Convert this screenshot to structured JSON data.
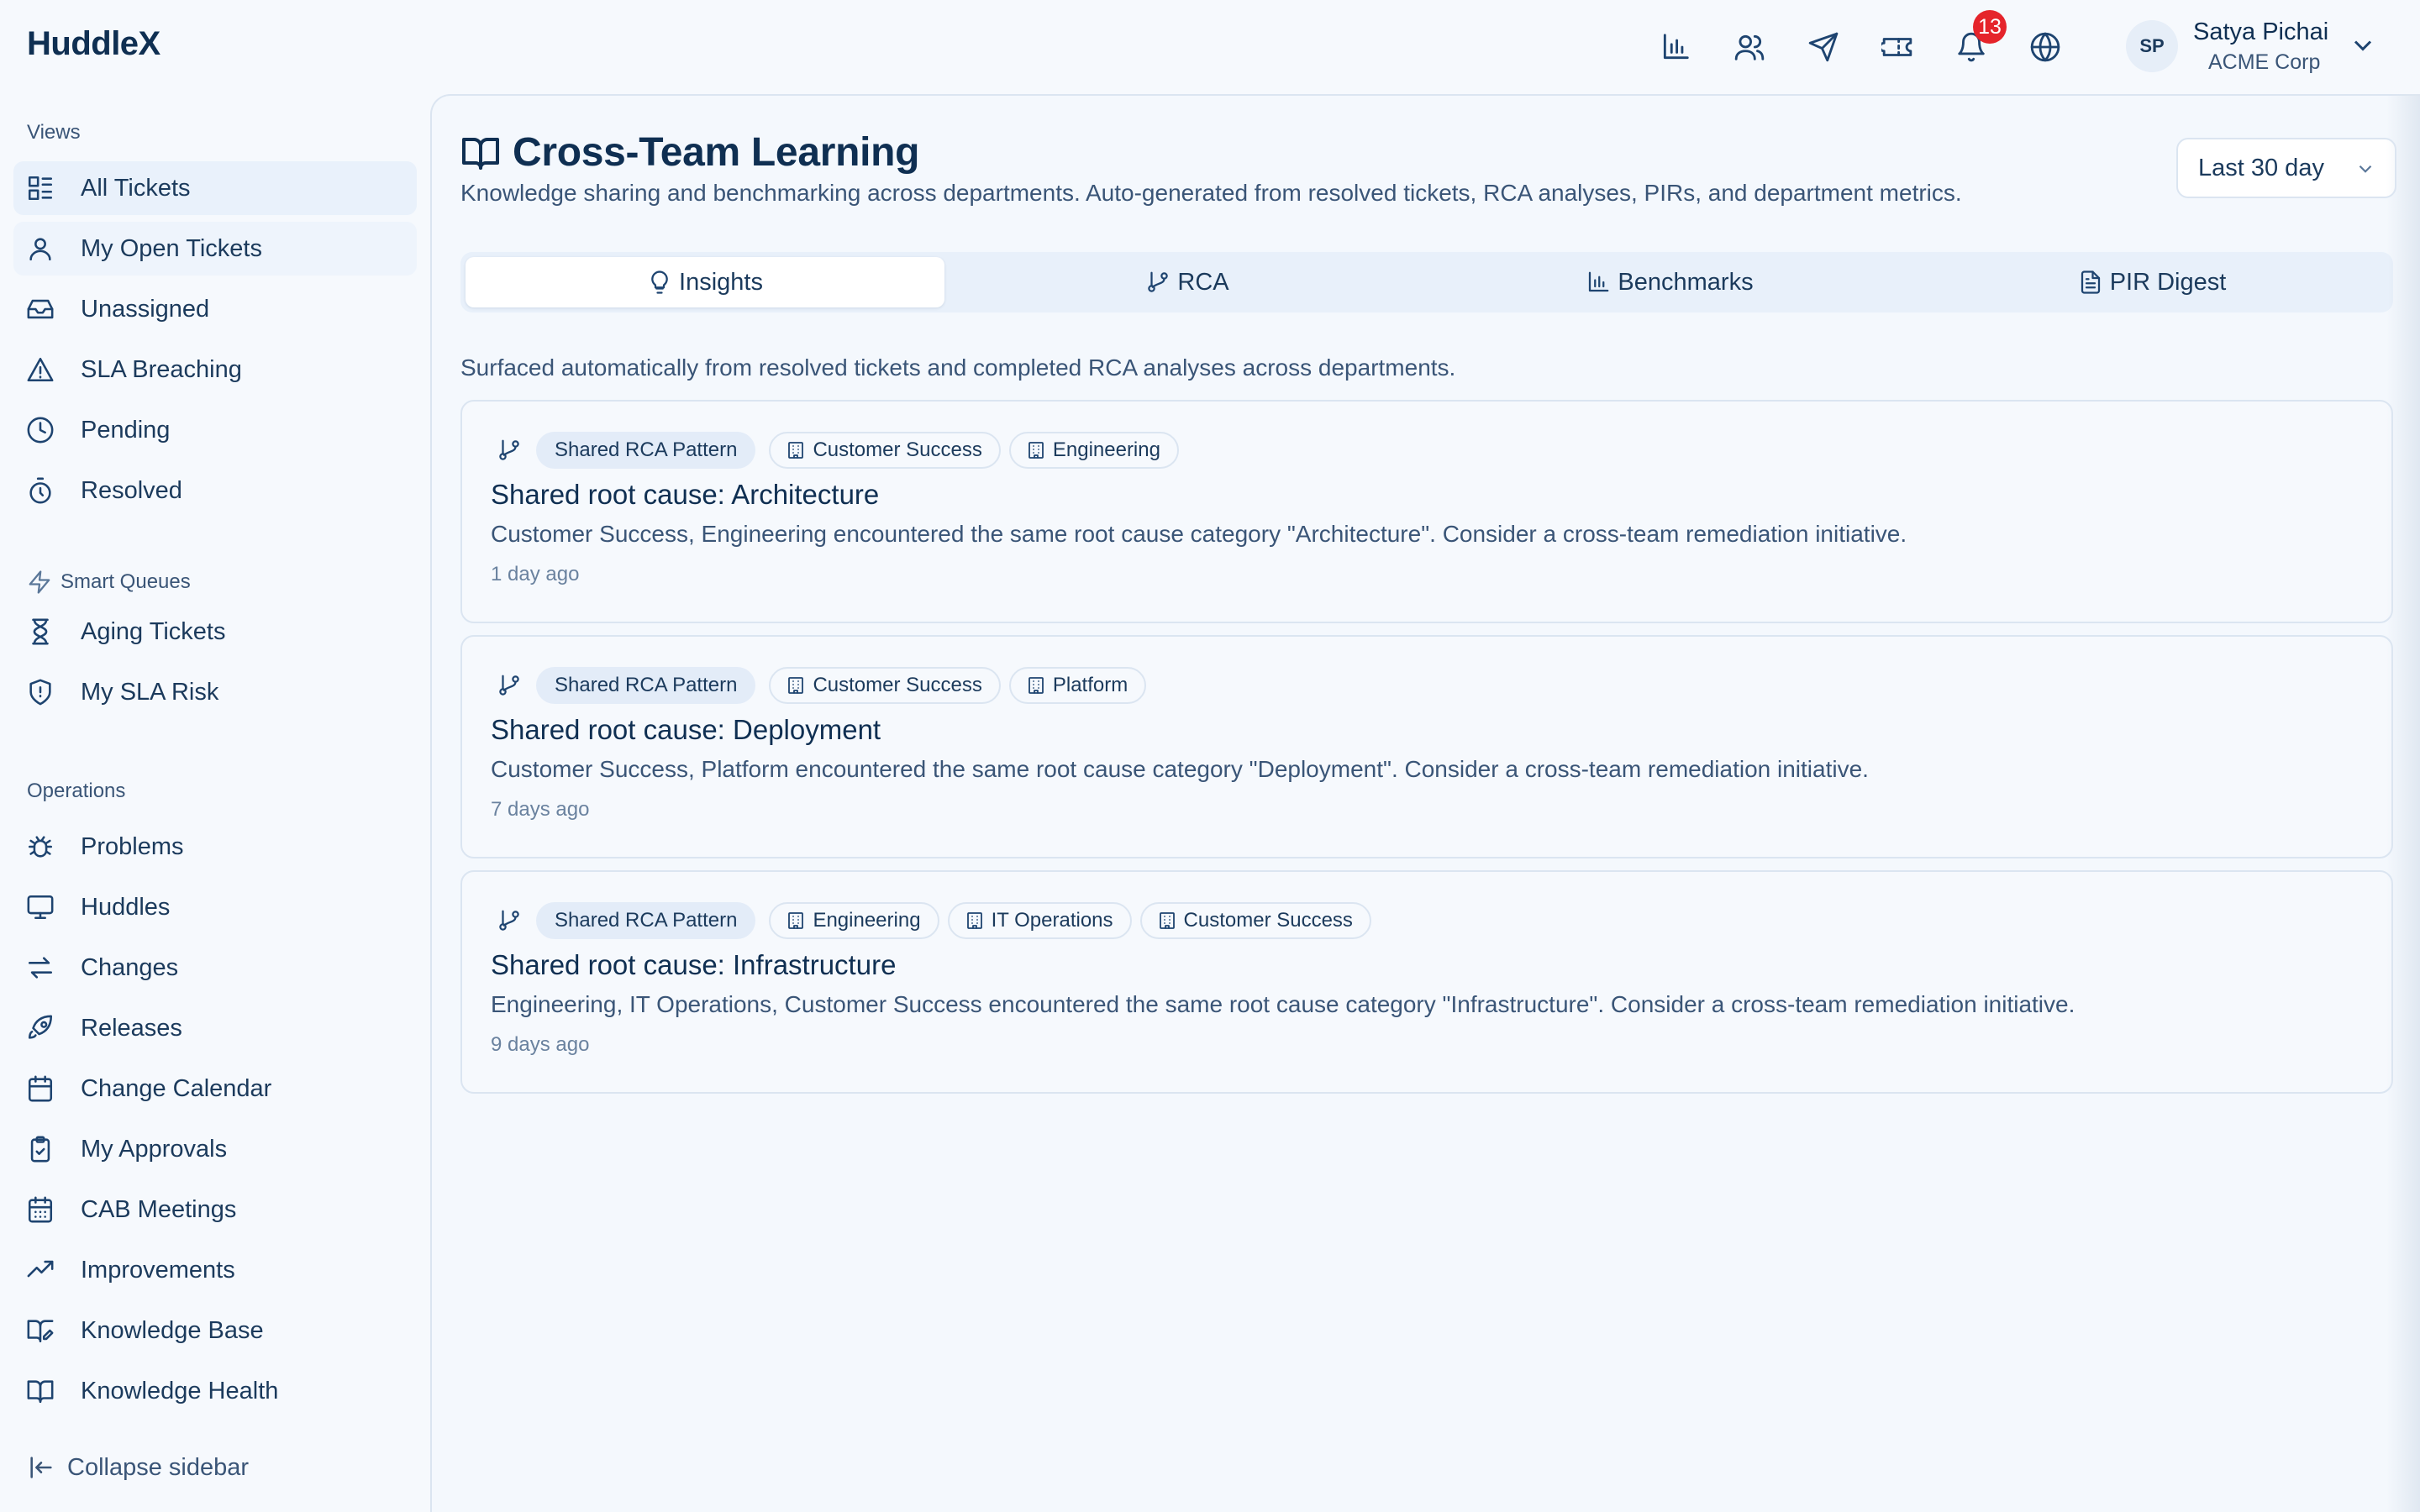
{
  "app": {
    "name": "HuddleX"
  },
  "topbar": {
    "icons": [
      "bar-chart-icon",
      "users-icon",
      "send-icon",
      "ticket-icon",
      "bell-icon",
      "globe-icon"
    ],
    "notification_count": "13",
    "user": {
      "initials": "SP",
      "name": "Satya Pichai",
      "org": "ACME Corp"
    }
  },
  "sidebar": {
    "views_label": "Views",
    "views": [
      {
        "label": "All Tickets",
        "icon": "list-icon"
      },
      {
        "label": "My Open Tickets",
        "icon": "user-icon"
      },
      {
        "label": "Unassigned",
        "icon": "inbox-icon"
      },
      {
        "label": "SLA Breaching",
        "icon": "warning-icon"
      },
      {
        "label": "Pending",
        "icon": "clock-icon"
      },
      {
        "label": "Resolved",
        "icon": "timer-icon"
      }
    ],
    "smart_label": "Smart Queues",
    "smart": [
      {
        "label": "Aging Tickets",
        "icon": "hourglass-icon"
      },
      {
        "label": "My SLA Risk",
        "icon": "shield-icon"
      }
    ],
    "ops_label": "Operations",
    "operations": [
      {
        "label": "Problems",
        "icon": "bug-icon"
      },
      {
        "label": "Huddles",
        "icon": "monitor-icon"
      },
      {
        "label": "Changes",
        "icon": "arrows-icon"
      },
      {
        "label": "Releases",
        "icon": "rocket-icon"
      },
      {
        "label": "Change Calendar",
        "icon": "calendar-icon"
      },
      {
        "label": "My Approvals",
        "icon": "clipboard-check-icon"
      },
      {
        "label": "CAB Meetings",
        "icon": "calendar-grid-icon"
      },
      {
        "label": "Improvements",
        "icon": "trending-up-icon"
      },
      {
        "label": "Knowledge Base",
        "icon": "book-edit-icon"
      },
      {
        "label": "Knowledge Health",
        "icon": "book-open-icon"
      }
    ],
    "collapse_label": "Collapse sidebar"
  },
  "main": {
    "title": "Cross-Team Learning",
    "subtitle": "Knowledge sharing and benchmarking across departments. Auto-generated from resolved tickets, RCA analyses, PIRs, and department metrics.",
    "range": "Last 30 day",
    "tabs": [
      {
        "label": "Insights",
        "icon": "lightbulb-icon"
      },
      {
        "label": "RCA",
        "icon": "git-branch-icon"
      },
      {
        "label": "Benchmarks",
        "icon": "bar-chart-icon"
      },
      {
        "label": "PIR Digest",
        "icon": "file-text-icon"
      }
    ],
    "intro": "Surfaced automatically from resolved tickets and completed RCA analyses across departments.",
    "insights": [
      {
        "tag": "Shared RCA Pattern",
        "departments": [
          "Customer Success",
          "Engineering"
        ],
        "title": "Shared root cause: Architecture",
        "description": "Customer Success, Engineering encountered the same root cause category \"Architecture\". Consider a cross-team remediation initiative.",
        "time": "1 day ago"
      },
      {
        "tag": "Shared RCA Pattern",
        "departments": [
          "Customer Success",
          "Platform"
        ],
        "title": "Shared root cause: Deployment",
        "description": "Customer Success, Platform encountered the same root cause category \"Deployment\". Consider a cross-team remediation initiative.",
        "time": "7 days ago"
      },
      {
        "tag": "Shared RCA Pattern",
        "departments": [
          "Engineering",
          "IT Operations",
          "Customer Success"
        ],
        "title": "Shared root cause: Infrastructure",
        "description": "Engineering, IT Operations, Customer Success encountered the same root cause category \"Infrastructure\". Consider a cross-team remediation initiative.",
        "time": "9 days ago"
      }
    ]
  }
}
